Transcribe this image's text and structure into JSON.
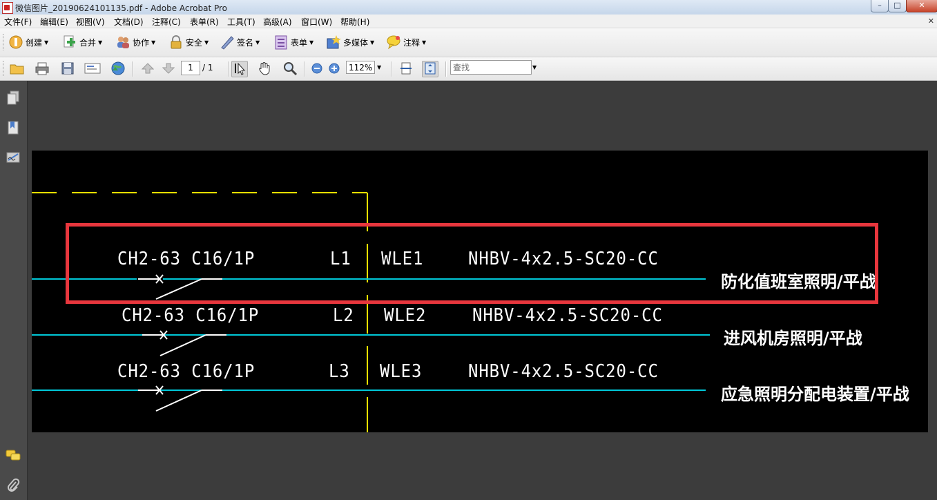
{
  "window": {
    "title": "微信图片_20190624101135.pdf - Adobe Acrobat Pro",
    "minimize": "–",
    "maximize": "□",
    "close": "✕"
  },
  "menu": {
    "items": [
      "文件(F)",
      "编辑(E)",
      "视图(V)",
      "文档(D)",
      "注释(C)",
      "表单(R)",
      "工具(T)",
      "高级(A)",
      "窗口(W)",
      "帮助(H)"
    ],
    "doc_close": "✕"
  },
  "toolbar1": {
    "items": [
      {
        "label": "创建",
        "icon": "create-pdf-icon",
        "color": "#e8a23a"
      },
      {
        "label": "合并",
        "icon": "combine-files-icon",
        "color": "#3aa34a"
      },
      {
        "label": "协作",
        "icon": "collaborate-icon",
        "color": "#5a7ec7"
      },
      {
        "label": "安全",
        "icon": "lock-icon",
        "color": "#d9a82c"
      },
      {
        "label": "签名",
        "icon": "pen-sign-icon",
        "color": "#6a7fb5"
      },
      {
        "label": "表单",
        "icon": "form-icon",
        "color": "#8a5bb3"
      },
      {
        "label": "多媒体",
        "icon": "multimedia-icon",
        "color": "#3a6fc0"
      },
      {
        "label": "注释",
        "icon": "comment-icon",
        "color": "#e8c43a"
      }
    ]
  },
  "toolbar2": {
    "page_current": "1",
    "page_total": "/ 1",
    "zoom": "112%",
    "find_placeholder": "查找"
  },
  "drawing": {
    "rows": [
      {
        "breaker": "CH2-63 C16/1P",
        "phase": "L1",
        "circuit": "WLE1",
        "cable": "NHBV-4x2.5-SC20-CC",
        "load": "防化值班室照明/平战"
      },
      {
        "breaker": "CH2-63 C16/1P",
        "phase": "L2",
        "circuit": "WLE2",
        "cable": "NHBV-4x2.5-SC20-CC",
        "load": "进风机房照明/平战"
      },
      {
        "breaker": "CH2-63 C16/1P",
        "phase": "L3",
        "circuit": "WLE3",
        "cable": "NHBV-4x2.5-SC20-CC",
        "load": "应急照明分配电装置/平战"
      }
    ],
    "colors": {
      "background": "#000000",
      "bus_line": "#00c8d8",
      "dashed_border": "#e8e000",
      "highlight": "#e8363d",
      "text": "#ffffff"
    }
  }
}
